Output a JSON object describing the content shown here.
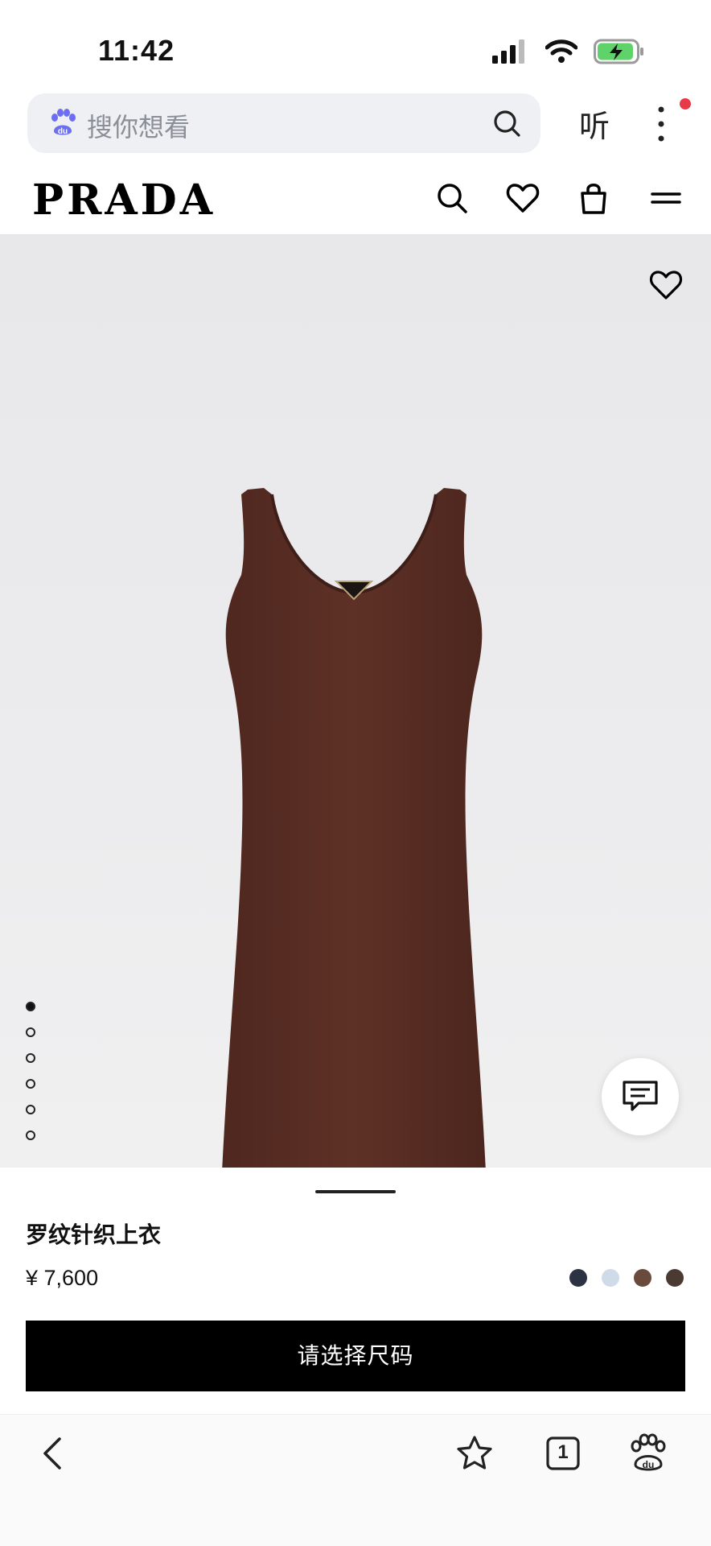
{
  "status": {
    "time": "11:42"
  },
  "browser": {
    "search_placeholder": "搜你想看",
    "listen_label": "听"
  },
  "header": {
    "brand": "PRADA"
  },
  "gallery": {
    "total_images": 6,
    "active_index": 0
  },
  "product": {
    "name": "罗纹针织上衣",
    "price": "¥ 7,600",
    "color_swatches": [
      "#2c3242",
      "#cfdbe8",
      "#6a4a3c",
      "#4a3a31"
    ],
    "cta_label": "请选择尺码"
  },
  "bottom_bar": {
    "tab_count": "1"
  },
  "colors": {
    "accent_red": "#e8394a",
    "garment": "#5a2e24",
    "battery_green": "#5fd36a"
  }
}
